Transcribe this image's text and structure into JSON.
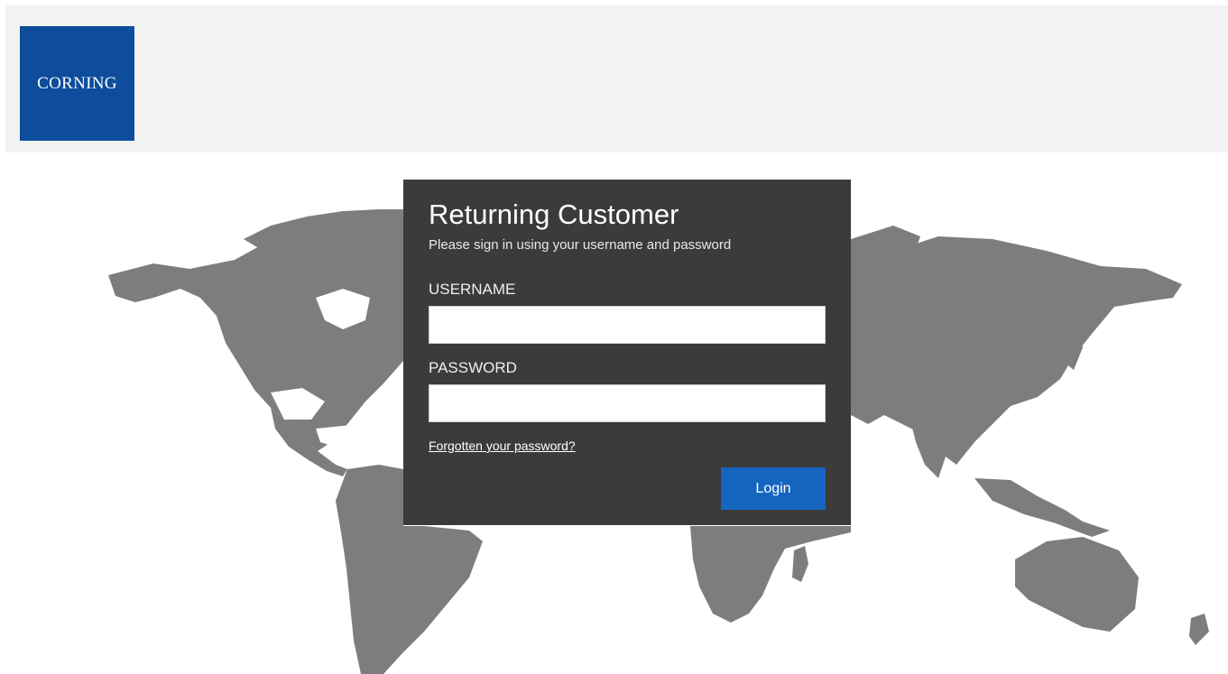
{
  "header": {
    "logo_text": "CORNING",
    "logo_color": "#0d4d9c",
    "background_color": "#f2f2f2"
  },
  "background": {
    "image": "world-map",
    "land_color": "#7d7d7d"
  },
  "login": {
    "title": "Returning Customer",
    "subtitle": "Please sign in using your username and password",
    "username_label": "USERNAME",
    "username_value": "",
    "password_label": "PASSWORD",
    "password_value": "",
    "forgot_link": "Forgotten your password?",
    "login_button": "Login",
    "panel_color": "#3b3b3b",
    "button_color": "#1565c0"
  }
}
